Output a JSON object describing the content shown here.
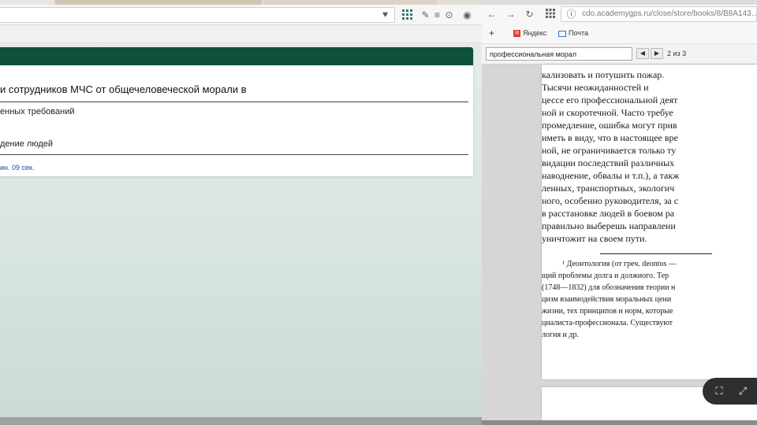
{
  "left": {
    "question": "и сотрудников МЧС от общечеловеческой морали в",
    "options": [
      "енных требований",
      "дение людей"
    ],
    "timer": "ин. 09 сек."
  },
  "right": {
    "url": "cdo.academygps.ru/close/store/books/8/B8A143…",
    "bookmarks": {
      "yandex": "Яндекс",
      "pochta": "Почта"
    },
    "find": {
      "query": "профессиональная морал",
      "count": "2 из 3"
    },
    "doc_lines": [
      "кализовать и потушить пожар.",
      "      Тысячи неожиданностей и",
      "цессе его профессиональной деят",
      "ной и скоротечной. Часто требуе",
      "промедление, ошибка могут прив",
      "иметь в виду, что в настоящее вре",
      "ной, не ограничивается только ту",
      "видации последствий различных",
      "наводнение, обвалы и т.п.), а такж",
      "ленных, транспортных, экологич",
      "ного, особенно руководителя, за с",
      "в расстановке людей в боевом ра",
      "правильно выберешь направлени",
      "уничтожит на своем пути."
    ],
    "footnote_lines": [
      "¹ Деонтология (от греч. deontos —",
      "щий проблемы долга и должного. Тер",
      "(1748—1832) для обозначения теории н",
      "цизм взаимодействия моральных цени",
      "жизни, тех принципов и норм, которые",
      "циалиста-профессионала. Существуют",
      "логия и др."
    ]
  },
  "colors": {
    "quiz_header": "#0e5038",
    "timer_text": "#1a4aa0",
    "viewer_controls": "#2f2f2f"
  },
  "icons": {
    "left_toolbar": [
      "heart-icon",
      "apps-grid-icon",
      "pen-icon",
      "menu-icon",
      "download-icon",
      "account-icon"
    ],
    "right_toolbar": [
      "back-icon",
      "forward-icon",
      "reload-icon",
      "apps-grid-icon",
      "info-icon"
    ],
    "viewer": [
      "fit-page-icon",
      "expand-icon"
    ]
  }
}
